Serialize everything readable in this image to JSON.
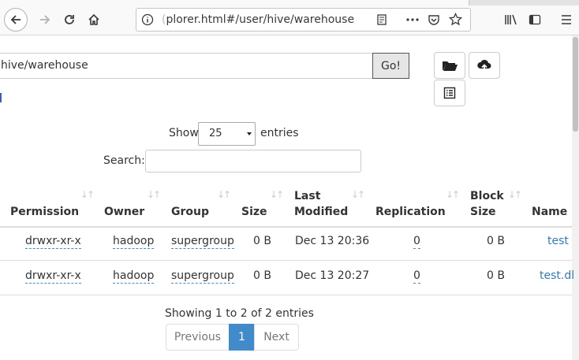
{
  "browser": {
    "url_prefix": "(",
    "url_text": "plorer.html#/user/hive/warehouse"
  },
  "toolbar": {
    "path_value": "hive/warehouse",
    "go_label": "Go!"
  },
  "datatable": {
    "show_label": "Show",
    "entries_value": "25",
    "entries_label": "entries",
    "search_label": "Search:",
    "search_value": "",
    "columns": {
      "permission": "Permission",
      "owner": "Owner",
      "group": "Group",
      "size": "Size",
      "last_modified_line1": "Last",
      "last_modified_line2": "Modified",
      "replication": "Replication",
      "block_size_line1": "Block",
      "block_size_line2": "Size",
      "name": "Name"
    },
    "rows": [
      {
        "permission": "drwxr-xr-x",
        "owner": "hadoop",
        "group": "supergroup",
        "size": "0 B",
        "modified": "Dec 13 20:36",
        "replication": "0",
        "block_size": "0 B",
        "name": "test"
      },
      {
        "permission": "drwxr-xr-x",
        "owner": "hadoop",
        "group": "supergroup",
        "size": "0 B",
        "modified": "Dec 13 20:27",
        "replication": "0",
        "block_size": "0 B",
        "name": "test.dl"
      }
    ],
    "info": "Showing 1 to 2 of 2 entries",
    "pagination": {
      "previous": "Previous",
      "current": "1",
      "next": "Next"
    }
  },
  "colors": {
    "accent": "#337ab7",
    "active_page": "#428bca"
  }
}
